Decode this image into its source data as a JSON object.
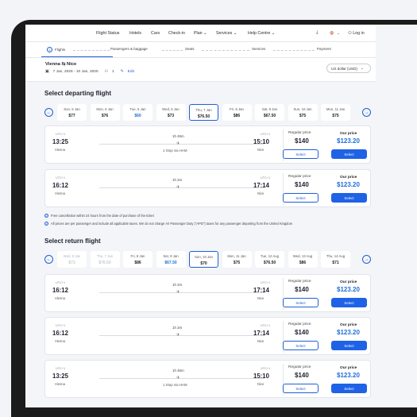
{
  "nav": {
    "links": [
      "Flight Status",
      "Hotels",
      "Cars",
      "Check-in",
      "Plan",
      "Services",
      "Help Centre"
    ],
    "login": "Log in"
  },
  "steps": [
    "Flights",
    "Passengers & baggage",
    "Seats",
    "Services",
    "Payment"
  ],
  "route": {
    "from": "Vienna",
    "to": "Nice",
    "dates": "7 Jan, 2025 - 10 Jan, 2025",
    "passengers": "1",
    "edit": "Edit",
    "currency": "US dollar (USD)"
  },
  "departing": {
    "title": "Select departing flight",
    "dates": [
      {
        "day": "Sun, 5 Jan",
        "price": "$77"
      },
      {
        "day": "Mon, 6 Jan",
        "price": "$76"
      },
      {
        "day": "Tue, 5 Jan",
        "price": "$60"
      },
      {
        "day": "Wed, 6 Jan",
        "price": "$73"
      },
      {
        "day": "Thu, 7 Jan",
        "price": "$76.50"
      },
      {
        "day": "Fri, 8 Jan",
        "price": "$86"
      },
      {
        "day": "Sat, 9 Jan",
        "price": "$67.50"
      },
      {
        "day": "Sun, 10 Jan",
        "price": "$75"
      },
      {
        "day": "Mon, 11 Jan",
        "price": "$75"
      }
    ],
    "flights": [
      {
        "utc_dep": "UTC+1",
        "dep": "13:25",
        "from": "Vienna",
        "duration": "1h 45m",
        "stop": "1 Stop via HAM",
        "utc_arr": "UTC+1",
        "arr": "15:10",
        "to": "Nice",
        "regular_label": "Regular price",
        "regular": "$140",
        "our_label": "Our price",
        "our": "$123.20",
        "select": "Select"
      },
      {
        "utc_dep": "UTC+1",
        "dep": "16:12",
        "from": "Vienna",
        "duration": "1h 2m",
        "stop": "",
        "utc_arr": "UTC+1",
        "arr": "17:14",
        "to": "Nice",
        "regular_label": "Regular price",
        "regular": "$140",
        "our_label": "Our price",
        "our": "$123.20",
        "select": "Select"
      }
    ]
  },
  "notes": [
    "Free cancellation within 24 hours from the date of purchase of the ticket",
    "All prices are per passenger and include all applicable taxes. We do not charge Air Passenger Duty (\"APD\") taxes for any passenger departing from the United Kingdom"
  ],
  "return": {
    "title": "Select return flight",
    "dates": [
      {
        "day": "Wed, 6 Jan",
        "price": "$73"
      },
      {
        "day": "Thu, 7 Jan",
        "price": "$76.50"
      },
      {
        "day": "Fri, 8 Jan",
        "price": "$86"
      },
      {
        "day": "Sat, 9 Jan",
        "price": "$67.50"
      },
      {
        "day": "Sun, 10 Jan",
        "price": "$70"
      },
      {
        "day": "Mon, 11 Jan",
        "price": "$75"
      },
      {
        "day": "Tue, 12 Aug",
        "price": "$76.50"
      },
      {
        "day": "Wed, 13 Aug",
        "price": "$86"
      },
      {
        "day": "Thu, 14 Aug",
        "price": "$71"
      }
    ],
    "flights": [
      {
        "utc_dep": "UTC+1",
        "dep": "16:12",
        "from": "Vienna",
        "duration": "1h 2m",
        "stop": "",
        "utc_arr": "UTC+1",
        "arr": "17:14",
        "to": "Nice",
        "regular_label": "Regular price",
        "regular": "$140",
        "our_label": "Our price",
        "our": "$123.20",
        "select": "Select"
      },
      {
        "utc_dep": "UTC+1",
        "dep": "16:12",
        "from": "Vienna",
        "duration": "1h 2m",
        "stop": "",
        "utc_arr": "UTC+1",
        "arr": "17:14",
        "to": "Nice",
        "regular_label": "Regular price",
        "regular": "$140",
        "our_label": "Our price",
        "our": "$123.20",
        "select": "Select"
      },
      {
        "utc_dep": "UTC+1",
        "dep": "13:25",
        "from": "Vienna",
        "duration": "1h 45m",
        "stop": "1 Stop via HAM",
        "utc_arr": "UTC+1",
        "arr": "15:10",
        "to": "Nice",
        "regular_label": "Regular price",
        "regular": "$140",
        "our_label": "Our price",
        "our": "$123.20",
        "select": "Select"
      }
    ]
  },
  "colors": {
    "accent": "#1f62e6",
    "low_price": "#1f6fd6"
  }
}
